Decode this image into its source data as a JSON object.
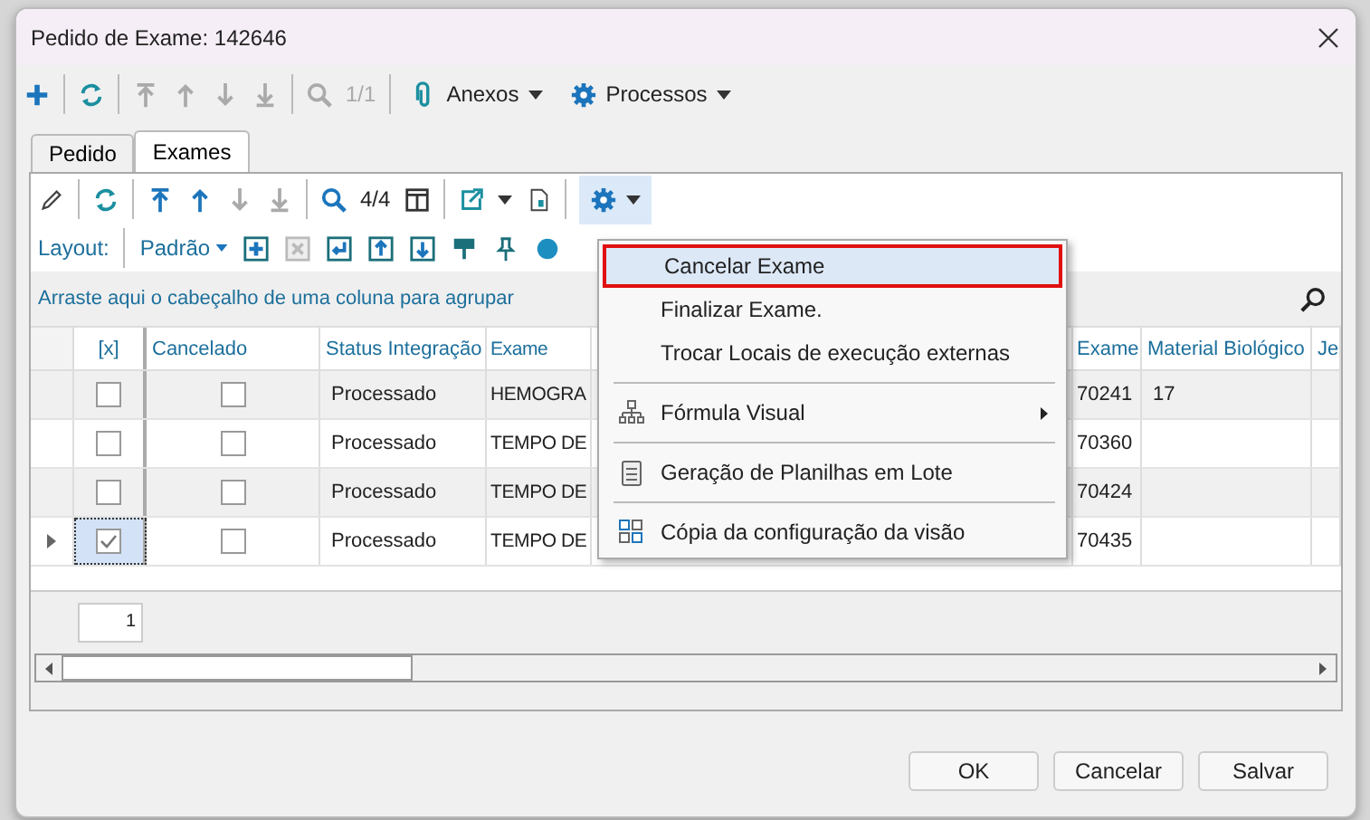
{
  "window": {
    "title": "Pedido de Exame: 142646"
  },
  "toolbar": {
    "counter": "1/1",
    "menus": [
      {
        "label": "Anexos"
      },
      {
        "label": "Processos"
      }
    ]
  },
  "tabs": [
    {
      "label": "Pedido",
      "selected": false
    },
    {
      "label": "Exames",
      "selected": true
    }
  ],
  "grid_toolbar": {
    "counter": "4/4",
    "layout_label": "Layout:",
    "layout_value": "Padrão",
    "gear_pressed": true
  },
  "group_panel": {
    "hint": "Arraste aqui o cabeçalho de uma coluna para agrupar"
  },
  "table": {
    "columns": [
      "[x]",
      "Cancelado",
      "Status Integração",
      "Exame",
      "",
      "Exame",
      "Material Biológico",
      "Je"
    ],
    "rows": [
      {
        "current": false,
        "checked": false,
        "cancelado": false,
        "status": "Processado",
        "exame": "HEMOGRA",
        "code": "70241",
        "material": "17"
      },
      {
        "current": false,
        "checked": false,
        "cancelado": false,
        "status": "Processado",
        "exame": "TEMPO DE",
        "code": "70360",
        "material": ""
      },
      {
        "current": false,
        "checked": false,
        "cancelado": false,
        "status": "Processado",
        "exame": "TEMPO DE",
        "code": "70424",
        "material": ""
      },
      {
        "current": true,
        "checked": true,
        "cancelado": false,
        "status": "Processado",
        "exame": "TEMPO DE",
        "code": "70435",
        "material": ""
      }
    ]
  },
  "footer": {
    "summary": "1"
  },
  "menu": {
    "groups": [
      [
        {
          "label": "Cancelar Exame",
          "selected": true,
          "submenu": false
        },
        {
          "label": "Finalizar Exame.",
          "selected": false,
          "submenu": false
        },
        {
          "label": "Trocar Locais de execução externas",
          "selected": false,
          "submenu": false
        }
      ],
      [
        {
          "label": "Fórmula Visual",
          "selected": false,
          "submenu": true
        }
      ],
      [
        {
          "label": "Geração de Planilhas em Lote",
          "selected": false,
          "submenu": false
        }
      ],
      [
        {
          "label": "Cópia da configuração da visão",
          "selected": false,
          "submenu": false
        }
      ]
    ]
  },
  "buttons": [
    "OK",
    "Cancelar",
    "Salvar"
  ]
}
